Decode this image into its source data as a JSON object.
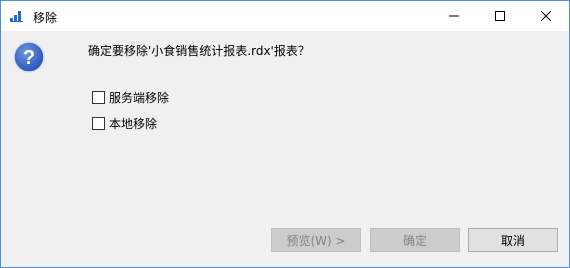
{
  "window": {
    "title": "移除",
    "app_icon": "bar-chart-icon",
    "controls": {
      "minimize": "minimize-icon",
      "maximize": "maximize-icon",
      "close": "close-icon"
    }
  },
  "dialog": {
    "icon": "question-icon",
    "message": "确定要移除'小食销售统计报表.rdx'报表？",
    "options": [
      {
        "label": "服务端移除",
        "checked": false
      },
      {
        "label": "本地移除",
        "checked": false
      }
    ]
  },
  "buttons": {
    "preview": "预览(W) >",
    "ok": "确定",
    "cancel": "取消"
  },
  "colors": {
    "accent_border": "#4f8fd6",
    "client_bg": "#f0f0f0",
    "disabled_button_bg": "#cccccc",
    "disabled_text": "#838383",
    "help_icon_blue": "#2a55b8"
  }
}
